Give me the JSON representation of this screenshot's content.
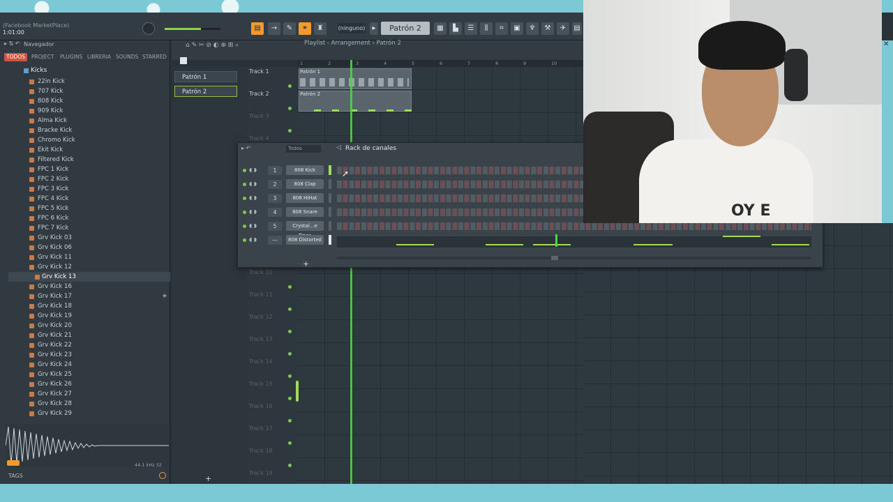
{
  "colors": {
    "accent_orange": "#f29a2e",
    "browser_active_tab": "#d0543f",
    "green_led": "#7ec84c",
    "playhead": "#4fd34a"
  },
  "hint": {
    "title": "(Facebook MarketPlace)",
    "value": "1:01:00"
  },
  "toolbar": {
    "pattern_selector": "(ninguno)",
    "pattern_name": "Patrón 2"
  },
  "browser": {
    "nav_label": "Navegador",
    "tabs": [
      "TODOS",
      "PROJECT",
      "PLUGINS",
      "LIBRERIA",
      "SOUNDS",
      "STARRED"
    ],
    "folder": "Kicks",
    "items": [
      "22in Kick",
      "707 Kick",
      "808 Kick",
      "909 Kick",
      "Alma Kick",
      "Bracke Kick",
      "Chromo Kick",
      "Ekit Kick",
      "Filtered Kick",
      "FPC 1 Kick",
      "FPC 2 Kick",
      "FPC 3 Kick",
      "FPC 4 Kick",
      "FPC 5 Kick",
      "FPC 6 Kick",
      "FPC 7 Kick",
      "Grv Kick 03",
      "Grv Kick 06",
      "Grv Kick 11",
      "Grv Kick 12",
      "Grv Kick 13",
      "Grv Kick 16",
      "Grv Kick 17",
      "Grv Kick 18",
      "Grv Kick 19",
      "Grv Kick 20",
      "Grv Kick 21",
      "Grv Kick 22",
      "Grv Kick 23",
      "Grv Kick 24",
      "Grv Kick 25",
      "Grv Kick 26",
      "Grv Kick 27",
      "Grv Kick 28",
      "Grv Kick 29"
    ],
    "selected": "Grv Kick 13",
    "wave_info": "44.1 kHz 32",
    "tags_label": "TAGS"
  },
  "patterns": [
    "Patrón 1",
    "Patrón 2"
  ],
  "playlist": {
    "title": "Playlist - Arrangement › Patrón 2",
    "ruler": [
      "1",
      "2",
      "3",
      "4",
      "5",
      "6",
      "7",
      "8",
      "9",
      "10"
    ],
    "tracks": [
      "Track 1",
      "Track 2",
      "Track 3",
      "Track 4",
      "Track 10",
      "Track 11",
      "Track 12",
      "Track 13",
      "Track 14",
      "Track 15",
      "Track 16",
      "Track 17",
      "Track 18",
      "Track 19"
    ],
    "clip_labels": [
      "Patrón 1",
      "Patrón 2"
    ]
  },
  "rack": {
    "title": "Rack de canales",
    "filter": "Todos",
    "channels": [
      {
        "num": "1",
        "name": "808 Kick"
      },
      {
        "num": "2",
        "name": "808 Clap"
      },
      {
        "num": "3",
        "name": "808 HiHat"
      },
      {
        "num": "4",
        "name": "808 Snare"
      },
      {
        "num": "5",
        "name": "Crystal...e Tines"
      },
      {
        "num": "---",
        "name": "808 Distorted"
      }
    ],
    "add_label": "+"
  },
  "webcam": {
    "shirt_text": "OY E"
  }
}
